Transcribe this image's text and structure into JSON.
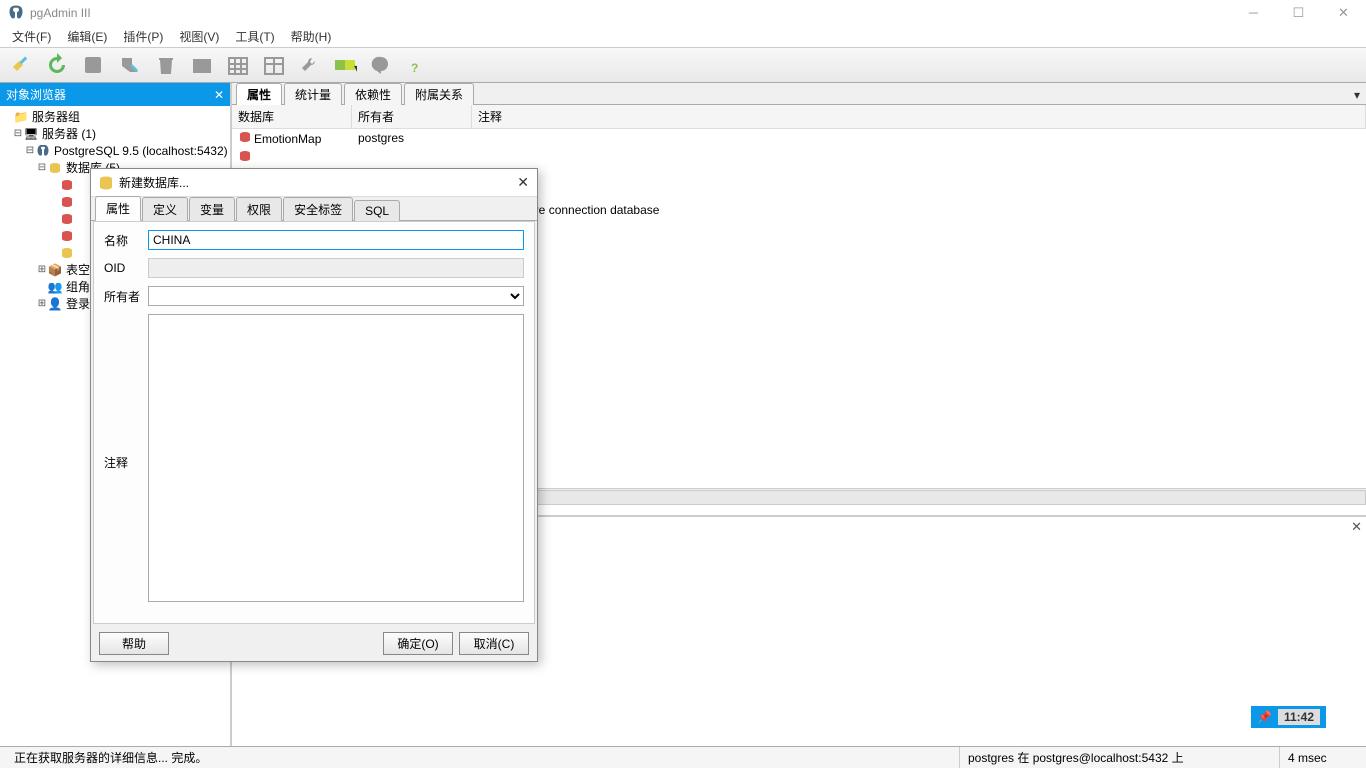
{
  "app_title": "pgAdmin III",
  "menus": [
    "文件(F)",
    "编辑(E)",
    "插件(P)",
    "视图(V)",
    "工具(T)",
    "帮助(H)"
  ],
  "sidebar": {
    "title": "对象浏览器",
    "root": "服务器组",
    "servers": "服务器 (1)",
    "server_node": "PostgreSQL 9.5 (localhost:5432)",
    "databases": "数据库 (5)",
    "tablespaces": "表空",
    "group_roles": "组角",
    "login_roles": "登录"
  },
  "content": {
    "tabs": [
      "属性",
      "统计量",
      "依赖性",
      "附属关系"
    ],
    "columns": [
      "数据库",
      "所有者",
      "注释"
    ],
    "rows": [
      {
        "db": "EmotionMap",
        "owner": "postgres",
        "comment": "",
        "icon": "red"
      },
      {
        "db": "",
        "owner": "",
        "comment": "",
        "icon": "red"
      }
    ],
    "partial_comment": "dministrative connection database"
  },
  "dialog": {
    "title": "新建数据库...",
    "tabs": [
      "属性",
      "定义",
      "变量",
      "权限",
      "安全标签",
      "SQL"
    ],
    "labels": {
      "name": "名称",
      "oid": "OID",
      "owner": "所有者",
      "comment": "注释"
    },
    "name_value": "CHINA",
    "oid_value": "",
    "buttons": {
      "help": "帮助",
      "ok": "确定(O)",
      "cancel": "取消(C)"
    }
  },
  "status": {
    "left": "正在获取服务器的详细信息... 完成。",
    "right": "postgres 在  postgres@localhost:5432 上",
    "time": "4 msec"
  },
  "clock": "11:42"
}
